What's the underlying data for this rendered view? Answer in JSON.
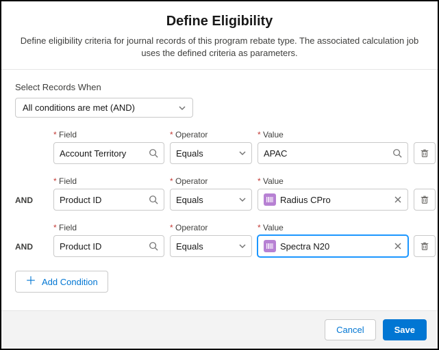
{
  "header": {
    "title": "Define Eligibility",
    "subtitle": "Define eligibility criteria for journal records of this program rebate type. The associated calculation job uses the defined criteria as parameters."
  },
  "selectWhen": {
    "label": "Select Records When",
    "value": "All conditions are met (AND)"
  },
  "labels": {
    "field": "Field",
    "operator": "Operator",
    "value": "Value",
    "required": "*"
  },
  "rows": [
    {
      "conj": "",
      "field": "Account Territory",
      "operator": "Equals",
      "value": "APAC",
      "valueType": "lookup-text",
      "focused": false
    },
    {
      "conj": "AND",
      "field": "Product ID",
      "operator": "Equals",
      "value": "Radius CPro",
      "valueType": "chip",
      "focused": false
    },
    {
      "conj": "AND",
      "field": "Product ID",
      "operator": "Equals",
      "value": "Spectra N20",
      "valueType": "chip",
      "focused": true
    }
  ],
  "addCondition": "Add Condition",
  "footer": {
    "cancel": "Cancel",
    "save": "Save"
  }
}
